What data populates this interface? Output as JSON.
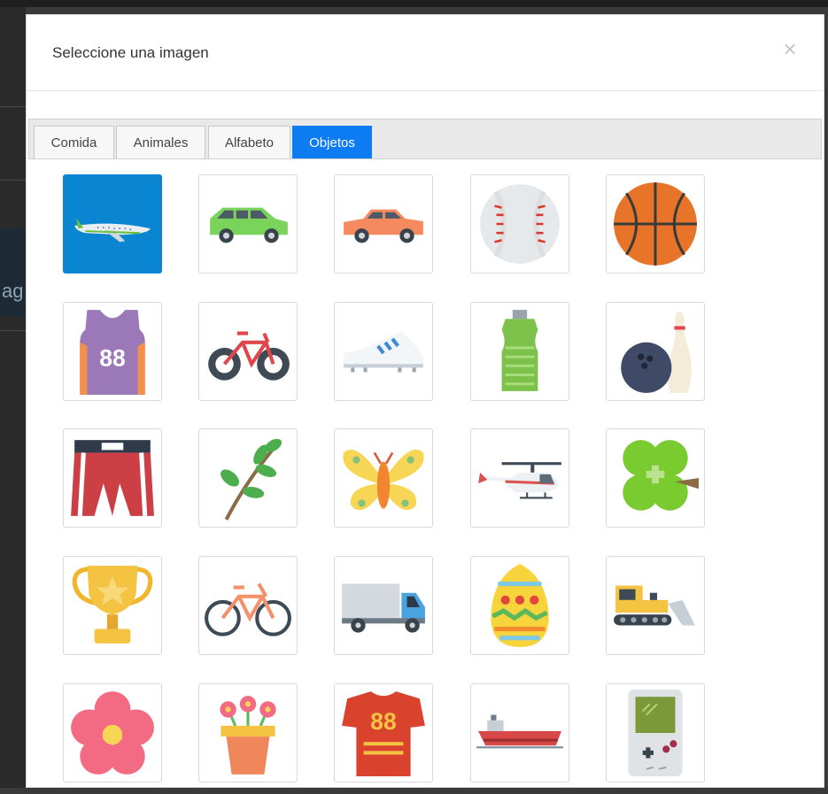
{
  "dialog": {
    "title": "Seleccione una imagen",
    "close_symbol": "×"
  },
  "tabs": [
    {
      "label": "Comida",
      "active": false
    },
    {
      "label": "Animales",
      "active": false
    },
    {
      "label": "Alfabeto",
      "active": false
    },
    {
      "label": "Objetos",
      "active": true
    }
  ],
  "colors": {
    "active_tab": "#0d7cf2",
    "selected_tile": "#0a85d1"
  },
  "images": [
    {
      "icon": "airplane-icon",
      "selected": true
    },
    {
      "icon": "green-suv-icon"
    },
    {
      "icon": "orange-car-icon"
    },
    {
      "icon": "baseball-icon"
    },
    {
      "icon": "basketball-icon"
    },
    {
      "icon": "jersey-88-icon",
      "number": "88"
    },
    {
      "icon": "bicycle-icon"
    },
    {
      "icon": "sneaker-icon"
    },
    {
      "icon": "water-bottle-icon"
    },
    {
      "icon": "bowling-icon"
    },
    {
      "icon": "boxing-shorts-icon"
    },
    {
      "icon": "leaf-branch-icon"
    },
    {
      "icon": "butterfly-icon"
    },
    {
      "icon": "helicopter-icon"
    },
    {
      "icon": "clover-icon"
    },
    {
      "icon": "trophy-icon"
    },
    {
      "icon": "city-bicycle-icon"
    },
    {
      "icon": "truck-icon"
    },
    {
      "icon": "easter-egg-icon"
    },
    {
      "icon": "bulldozer-icon"
    },
    {
      "icon": "flower-icon"
    },
    {
      "icon": "flower-pot-icon"
    },
    {
      "icon": "football-jersey-icon",
      "number": "88"
    },
    {
      "icon": "ship-icon"
    },
    {
      "icon": "game-console-icon"
    }
  ]
}
